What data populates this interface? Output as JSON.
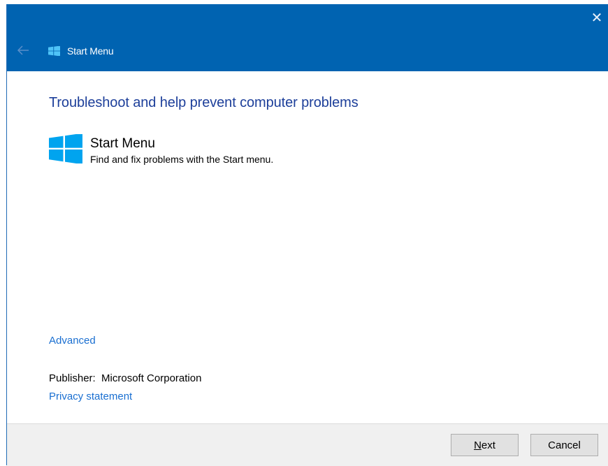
{
  "window": {
    "title": "Start Menu",
    "close_glyph": "✕",
    "colors": {
      "titlebar": "#0063b1",
      "heading": "#1d3f9a",
      "link": "#1a6fd1",
      "icon": "#00a4ef"
    }
  },
  "main": {
    "heading": "Troubleshoot and help prevent computer problems",
    "item": {
      "icon": "windows-logo-icon",
      "title": "Start Menu",
      "description": "Find and fix problems with the Start menu."
    },
    "advanced_link": "Advanced",
    "publisher_label": "Publisher:",
    "publisher_value": "Microsoft Corporation",
    "privacy_link": "Privacy statement"
  },
  "footer": {
    "next_access_key": "N",
    "next_rest": "ext",
    "cancel_label": "Cancel"
  }
}
